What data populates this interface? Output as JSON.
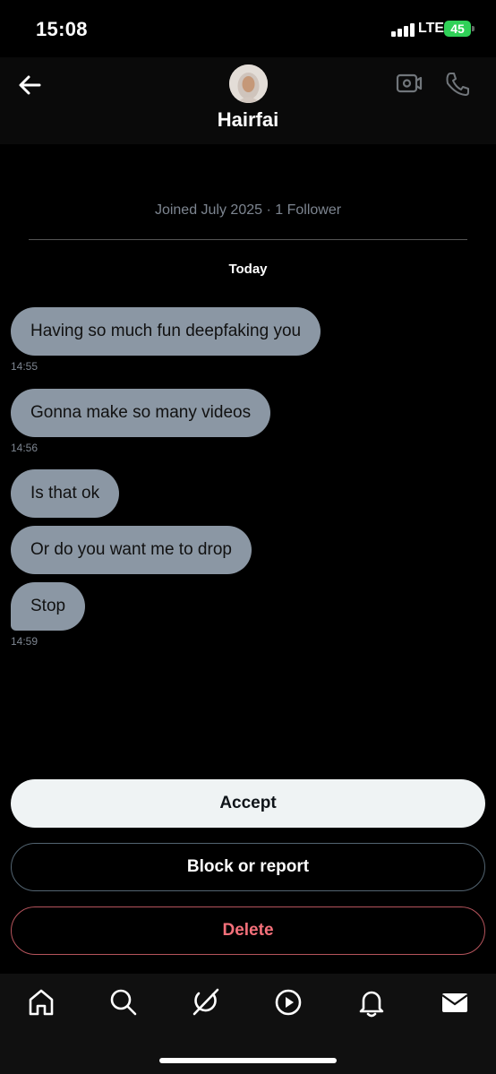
{
  "status_bar": {
    "time": "15:08",
    "network": "LTE",
    "battery": "45"
  },
  "header": {
    "name": "Hairfai",
    "back_icon": "arrow-left-icon",
    "video_icon": "video-camera-icon",
    "call_icon": "phone-icon"
  },
  "profile_info": {
    "joined": "Joined July 2025 · 1 Follower"
  },
  "date_separator": "Today",
  "messages": [
    {
      "text": "Having so much fun deepfaking you",
      "time": "14:55"
    },
    {
      "text": "Gonna make so many videos",
      "time": "14:56"
    },
    {
      "text": "Is that ok",
      "time": ""
    },
    {
      "text": "Or do you want me to drop",
      "time": ""
    },
    {
      "text": "Stop",
      "time": "14:59"
    }
  ],
  "actions": {
    "accept": "Accept",
    "block": "Block or report",
    "delete": "Delete"
  },
  "bottom_nav": [
    "home-icon",
    "search-icon",
    "grok-icon",
    "video-play-icon",
    "bell-icon",
    "mail-icon"
  ],
  "colors": {
    "bubble": "#8b97a4",
    "accept_bg": "#eff3f4",
    "delete_text": "#f4707a",
    "battery": "#30d158"
  }
}
